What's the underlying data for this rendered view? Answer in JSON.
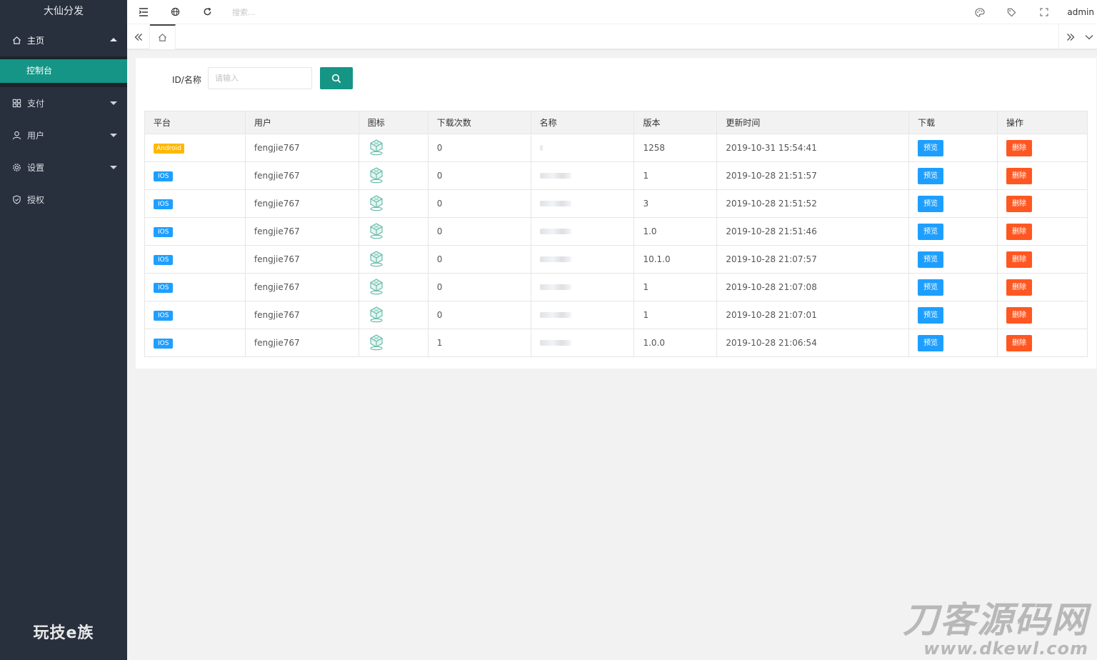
{
  "sidebar": {
    "title": "大仙分发",
    "main": {
      "label": "主页",
      "icon": "home-icon"
    },
    "sub_item": {
      "label": "控制台"
    },
    "items": [
      {
        "label": "支付",
        "icon": "apps-icon"
      },
      {
        "label": "用户",
        "icon": "user-icon"
      },
      {
        "label": "设置",
        "icon": "gear-icon"
      },
      {
        "label": "授权",
        "icon": "shield-icon"
      }
    ],
    "brand": "玩技e族"
  },
  "topbar": {
    "search_placeholder": "搜索...",
    "user": "admin"
  },
  "filter": {
    "label": "ID/名称",
    "placeholder": "请输入"
  },
  "table": {
    "headers": [
      "平台",
      "用户",
      "图标",
      "下载次数",
      "名称",
      "版本",
      "更新时间",
      "下载",
      "操作"
    ],
    "preview_label": "预览",
    "delete_label": "删除",
    "rows": [
      {
        "platform": "Android",
        "user": "fengjie767",
        "downloads": "0",
        "version": "1258",
        "updated": "2019-10-31 15:54:41"
      },
      {
        "platform": "IOS",
        "user": "fengjie767",
        "downloads": "0",
        "version": "1",
        "updated": "2019-10-28 21:51:57"
      },
      {
        "platform": "IOS",
        "user": "fengjie767",
        "downloads": "0",
        "version": "3",
        "updated": "2019-10-28 21:51:52"
      },
      {
        "platform": "IOS",
        "user": "fengjie767",
        "downloads": "0",
        "version": "1.0",
        "updated": "2019-10-28 21:51:46"
      },
      {
        "platform": "IOS",
        "user": "fengjie767",
        "downloads": "0",
        "version": "10.1.0",
        "updated": "2019-10-28 21:07:57"
      },
      {
        "platform": "IOS",
        "user": "fengjie767",
        "downloads": "0",
        "version": "1",
        "updated": "2019-10-28 21:07:08"
      },
      {
        "platform": "IOS",
        "user": "fengjie767",
        "downloads": "0",
        "version": "1",
        "updated": "2019-10-28 21:07:01"
      },
      {
        "platform": "IOS",
        "user": "fengjie767",
        "downloads": "1",
        "version": "1.0.0",
        "updated": "2019-10-28 21:06:54"
      }
    ]
  },
  "watermark": {
    "line1": "刀客源码网",
    "line2": "www.dkewl.com"
  },
  "colors": {
    "sidebar_bg": "#28303d",
    "accent": "#159585",
    "preview_blue": "#1e9fff",
    "delete_orange": "#ff5722",
    "android_badge": "#ffb800"
  }
}
